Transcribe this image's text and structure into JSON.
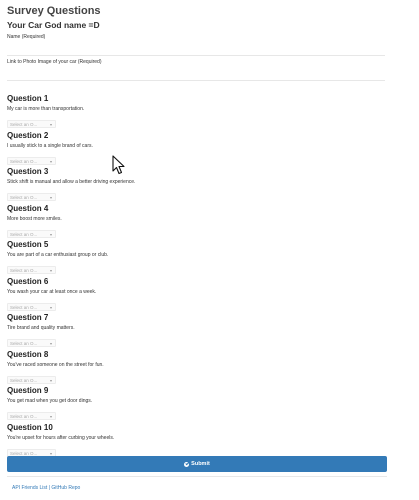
{
  "header": {
    "title": "Survey Questions",
    "subtitle": "Your Car God name =D"
  },
  "fields": {
    "name_label": "Name (Required)",
    "name_value": "",
    "photo_label": "Link to Photo Image of your car (Required)",
    "photo_value": ""
  },
  "questions": [
    {
      "title": "Question 1",
      "text": "My car is more than transportation.",
      "select": "Select an O..."
    },
    {
      "title": "Question 2",
      "text": "I usually stick to a single brand of cars.",
      "select": "Select an O..."
    },
    {
      "title": "Question 3",
      "text": "Stick shift is manual and allow a better driving experience.",
      "select": "Select an O..."
    },
    {
      "title": "Question 4",
      "text": "More boost more smiles.",
      "select": "Select an O..."
    },
    {
      "title": "Question 5",
      "text": "You are part of a car enthusiast group or club.",
      "select": "Select an O..."
    },
    {
      "title": "Question 6",
      "text": "You wash your car at least once a week.",
      "select": "Select an O..."
    },
    {
      "title": "Question 7",
      "text": "Tire brand and quality matters.",
      "select": "Select an O..."
    },
    {
      "title": "Question 8",
      "text": "You've raced someone on the street for fun.",
      "select": "Select an O..."
    },
    {
      "title": "Question 9",
      "text": "You get mad when you get door dings.",
      "select": "Select an O..."
    },
    {
      "title": "Question 10",
      "text": "You're upset for hours after curbing your wheels.",
      "select": "Select an O..."
    }
  ],
  "submit": {
    "label": "Submit",
    "icon": "check-circle-icon",
    "color": "#337ab7"
  },
  "footer": {
    "link1": "API Friends List",
    "separator": "|",
    "link2": "GitHub Repo"
  }
}
